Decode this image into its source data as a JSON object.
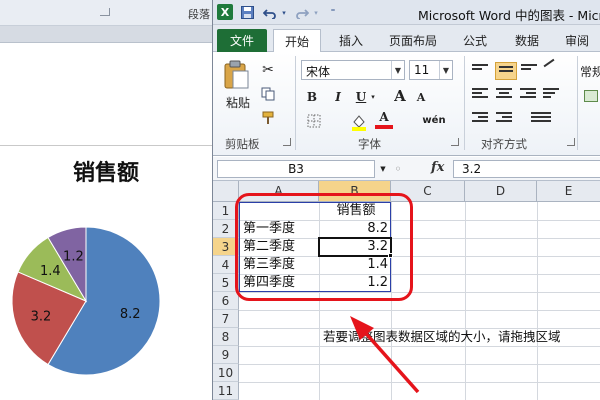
{
  "word": {
    "group_label": "段落",
    "chart_title": "销售额"
  },
  "chart_data": {
    "type": "pie",
    "title": "销售额",
    "categories": [
      "第一季度",
      "第二季度",
      "第三季度",
      "第四季度"
    ],
    "values": [
      8.2,
      3.2,
      1.4,
      1.2
    ],
    "colors": [
      "#4f81bd",
      "#c0504d",
      "#9bbb59",
      "#8064a2"
    ]
  },
  "excel": {
    "logo": "X",
    "window_title": "Microsoft Word 中的图表 - Micr",
    "tabs": {
      "file": "文件",
      "home": "开始",
      "insert": "插入",
      "page_layout": "页面布局",
      "formulas": "公式",
      "data": "数据",
      "review": "审阅"
    },
    "ribbon": {
      "paste_label": "粘贴",
      "clipboard_label": "剪贴板",
      "font_name": "宋体",
      "font_size": "11",
      "bold": "B",
      "italic": "I",
      "underline": "U",
      "grow_font": "A",
      "shrink_font": "A",
      "font_color": "A",
      "phonetic": "wén",
      "font_group_label": "字体",
      "align_group_label": "对齐方式",
      "number_format": "常规"
    },
    "formula_bar": {
      "name_box": "B3",
      "fx": "fx",
      "value": "3.2"
    },
    "columns": [
      "A",
      "B",
      "C",
      "D",
      "E"
    ],
    "rows": [
      "1",
      "2",
      "3",
      "4",
      "5",
      "6",
      "7",
      "8",
      "9",
      "10",
      "11"
    ],
    "table": {
      "header": "销售额",
      "labels": [
        "第一季度",
        "第二季度",
        "第三季度",
        "第四季度"
      ],
      "values": [
        "8.2",
        "3.2",
        "1.4",
        "1.2"
      ]
    },
    "hint_text": "若要调整图表数据区域的大小，请拖拽区域",
    "selected_cell": "B3",
    "accent_color": "#1e6e36",
    "annotation_color": "#e5141b"
  }
}
